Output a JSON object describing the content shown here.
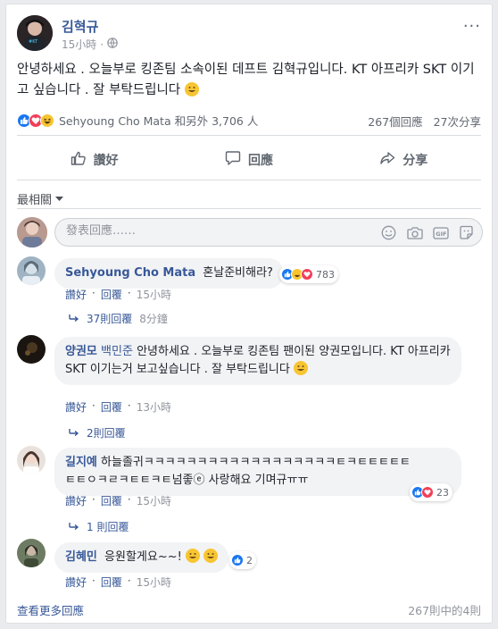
{
  "post": {
    "author": "김혁규",
    "time": "15小時",
    "dot": "·",
    "more": "···",
    "text": "안녕하세요 . 오늘부로 킹존팀 소속이된 데프트 김혁규입니다. KT 아프리카 SKT 이기고 싶습니다 . 잘 부탁드립니다"
  },
  "stats": {
    "reactors": "Sehyoung Cho Mata 和另外 3,706 人",
    "comments": "267個回應",
    "shares": "27次分享"
  },
  "actions": {
    "like": "讚好",
    "comment": "回應",
    "share": "分享"
  },
  "sort": {
    "label": "最相關"
  },
  "composer": {
    "placeholder": "發表回應……"
  },
  "comments": [
    {
      "name": "Sehyoung Cho Mata",
      "text": "혼날준비해라?",
      "reaction_count": "783",
      "like": "讚好",
      "reply": "回覆",
      "time": "15小時",
      "replies_label": "37則回覆",
      "replies_time": "8分鐘"
    },
    {
      "name": "양권모",
      "tag": "백민준",
      "text": "안녕하세요 . 오늘부로 킹존팀 팬이된 양권모입니다. KT 아프리카 SKT 이기는거 보고싶습니다 . 잘 부탁드립니다",
      "like": "讚好",
      "reply": "回覆",
      "time": "13小時",
      "replies_label": "2則回覆"
    },
    {
      "name": "길지예",
      "text_line1": "하늘졸귀ㅋㅋㅋㅋㅋㅋㅋㅋㅋㅋㅋㅋㅋㅋㅋㅋㅋㅋㅌㅋㅌㅌㅌㅌㅌ",
      "text_line2": "ㅌㅌㅇㅋㄹㅋㅌㅌㅋㅌ넘좋ⓔ 사랑해요 기며규ㅠㅠ",
      "reaction_count": "23",
      "like": "讚好",
      "reply": "回覆",
      "time": "15小時",
      "replies_label": "1 則回覆"
    },
    {
      "name": "김혜민",
      "text": "응원할게요~~!",
      "reaction_count": "2",
      "like": "讚好",
      "reply": "回覆",
      "time": "15小時"
    }
  ],
  "footer": {
    "more": "查看更多回應",
    "count": "267則中的4則"
  },
  "colors": {
    "link": "#385898",
    "like_blue": "#1877f2",
    "love_red": "#f33e58",
    "bubble": "#f2f3f5"
  }
}
